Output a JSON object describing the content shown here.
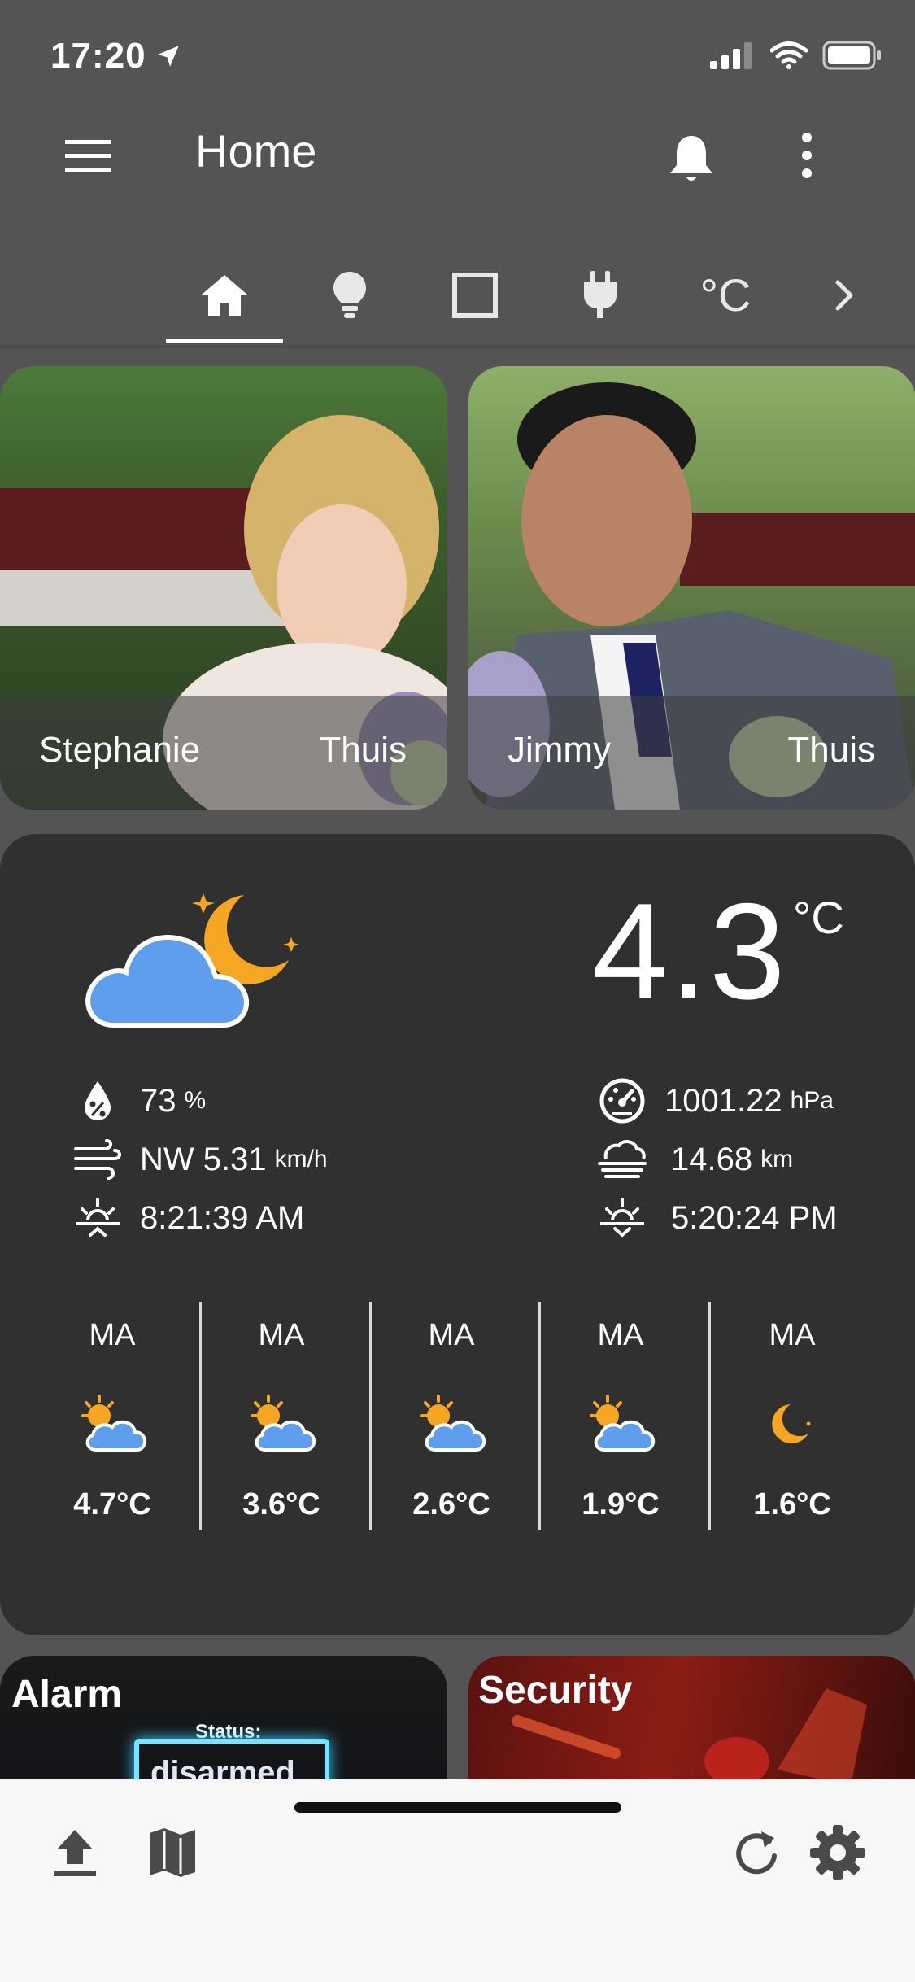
{
  "status_bar": {
    "time": "17:20"
  },
  "header": {
    "title": "Home"
  },
  "tabs": [
    {
      "icon": "home-icon",
      "active": true
    },
    {
      "icon": "lightbulb-icon",
      "active": false
    },
    {
      "icon": "square-icon",
      "active": false
    },
    {
      "icon": "plug-icon",
      "active": false
    },
    {
      "icon": "celsius-icon",
      "label": "°C",
      "active": false
    },
    {
      "icon": "chevron-right-icon",
      "active": false
    }
  ],
  "persons": [
    {
      "name": "Stephanie",
      "state": "Thuis"
    },
    {
      "name": "Jimmy",
      "state": "Thuis"
    }
  ],
  "weather": {
    "temperature": "4.3",
    "unit": "°C",
    "condition_icon": "partly-cloudy-night-icon",
    "humidity": {
      "value": "73",
      "unit": "%"
    },
    "wind": {
      "value": "NW 5.31",
      "unit": "km/h"
    },
    "sunrise": "8:21:39 AM",
    "pressure": {
      "value": "1001.22",
      "unit": "hPa"
    },
    "visibility": {
      "value": "14.68",
      "unit": "km"
    },
    "sunset": "5:20:24 PM",
    "forecast": [
      {
        "day": "MA",
        "temp": "4.7°C",
        "icon": "partly-sunny-icon"
      },
      {
        "day": "MA",
        "temp": "3.6°C",
        "icon": "partly-sunny-icon"
      },
      {
        "day": "MA",
        "temp": "2.6°C",
        "icon": "partly-sunny-icon"
      },
      {
        "day": "MA",
        "temp": "1.9°C",
        "icon": "partly-sunny-icon"
      },
      {
        "day": "MA",
        "temp": "1.6°C",
        "icon": "moon-icon"
      }
    ]
  },
  "tiles": {
    "alarm": {
      "title": "Alarm",
      "status_label": "Status:",
      "status_value": "disarmed"
    },
    "security": {
      "title": "Security"
    }
  },
  "colors": {
    "background": "#545454",
    "card": "#303030",
    "cloud_blue": "#5f9ded",
    "moon_orange": "#f5a623",
    "toolbar": "#f7f7f7"
  }
}
